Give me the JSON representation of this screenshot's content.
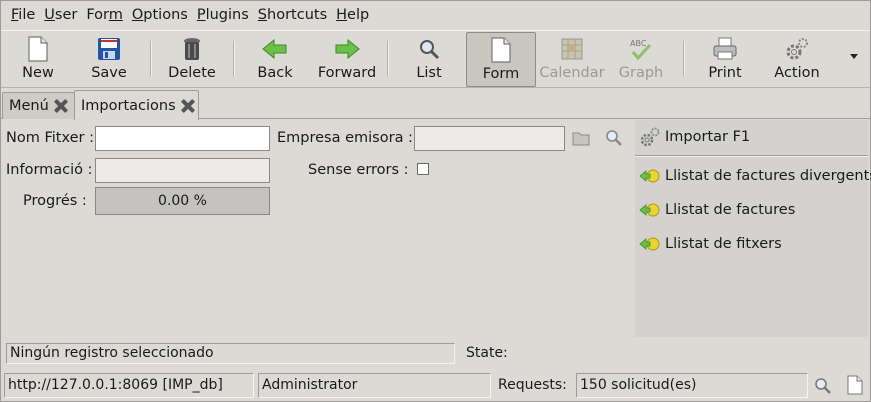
{
  "menubar": {
    "items": [
      {
        "key": "F",
        "rest": "ile"
      },
      {
        "key": "U",
        "rest": "ser"
      },
      {
        "key": "",
        "pre": "For",
        "keymid": "m"
      },
      {
        "key": "O",
        "rest": "ptions"
      },
      {
        "key": "P",
        "rest": "lugins"
      },
      {
        "key": "S",
        "rest": "hortcuts"
      },
      {
        "key": "H",
        "rest": "elp"
      }
    ]
  },
  "toolbar": {
    "new": "New",
    "save": "Save",
    "delete": "Delete",
    "back": "Back",
    "forward": "Forward",
    "list": "List",
    "form": "Form",
    "calendar": "Calendar",
    "graph": "Graph",
    "print": "Print",
    "action": "Action"
  },
  "tabs": [
    {
      "label": "Menú"
    },
    {
      "label": "Importacions"
    }
  ],
  "form": {
    "nom_fitxer_label": "Nom Fitxer :",
    "nom_fitxer_value": "",
    "empresa_label": "Empresa emisora :",
    "empresa_value": "",
    "informacio_label": "Informació :",
    "informacio_value": "",
    "sense_errors_label": "Sense errors :",
    "sense_errors_checked": false,
    "progres_label": "Progrés :",
    "progres_value": "0.00 %",
    "progres_fraction": 0.0
  },
  "side_panel": {
    "action": "Importar F1",
    "reports": [
      "Llistat de factures divergents",
      "Llistat de factures",
      "Llistat de fitxers"
    ]
  },
  "status": {
    "message": "Ningún registro seleccionado",
    "state_label": "State:",
    "server": "http://127.0.0.1:8069 [IMP_db]",
    "user": "Administrator",
    "requests_label": "Requests:",
    "requests_value": "150 solicitud(es)"
  },
  "colors": {
    "window_bg": "#dcdad5",
    "panel_bg": "#d3d2cf",
    "green_arrow": "#4caa2a",
    "save_blue": "#2255a4",
    "save_red": "#c8302a"
  }
}
